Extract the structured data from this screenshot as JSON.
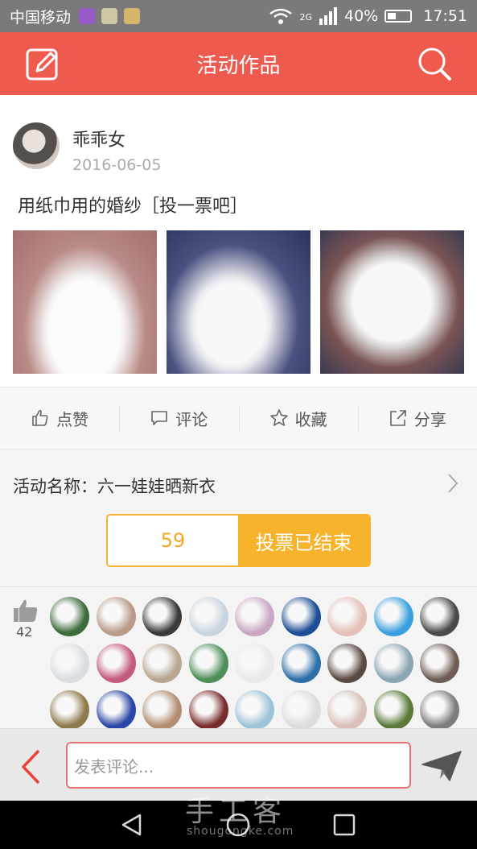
{
  "status_bar": {
    "carrier": "中国移动",
    "network": "2G",
    "battery": "40%",
    "battery_level": 0.4,
    "time": "17:51"
  },
  "header": {
    "title": "活动作品",
    "left_icon": "edit-icon",
    "right_icon": "search-icon",
    "color": "#ef5a4f"
  },
  "post": {
    "author": "乖乖女",
    "date": "2016-06-05",
    "title": "用纸巾用的婚纱［投一票吧］"
  },
  "actions": [
    {
      "label": "点赞",
      "icon": "thumbs-up-icon"
    },
    {
      "label": "评论",
      "icon": "comment-icon"
    },
    {
      "label": "收藏",
      "icon": "star-icon"
    },
    {
      "label": "分享",
      "icon": "share-icon"
    }
  ],
  "activity": {
    "name": "活动名称：六一娃娃晒新衣",
    "vote_count": "59",
    "vote_status": "投票已结束",
    "accent": "#f6b32b"
  },
  "likes": {
    "count": "42",
    "avatars": [
      "#3c6b3c",
      "#b99a88",
      "#3a3a3a",
      "#c9d5de",
      "#c9a7c4",
      "#1c4d96",
      "#e3c1b8",
      "#3aa0dd",
      "#4a4a4a",
      "#d9dde0",
      "#c45a7c",
      "#b8a690",
      "#4e8f5a",
      "#e9e9e9",
      "#2f6fa8",
      "#5a4a44",
      "#8aa6b3",
      "#6e5d55",
      "#8c7a4a",
      "#2a46a8",
      "#b38d70",
      "#7a2c2c",
      "#9cc3d8",
      "#dcdcdc",
      "#d9c0b8",
      "#5b7a3a",
      "#7d7d7d"
    ]
  },
  "comment": {
    "placeholder": "发表评论..."
  },
  "watermark": {
    "text": "手工客",
    "sub": "shougongke.com"
  }
}
